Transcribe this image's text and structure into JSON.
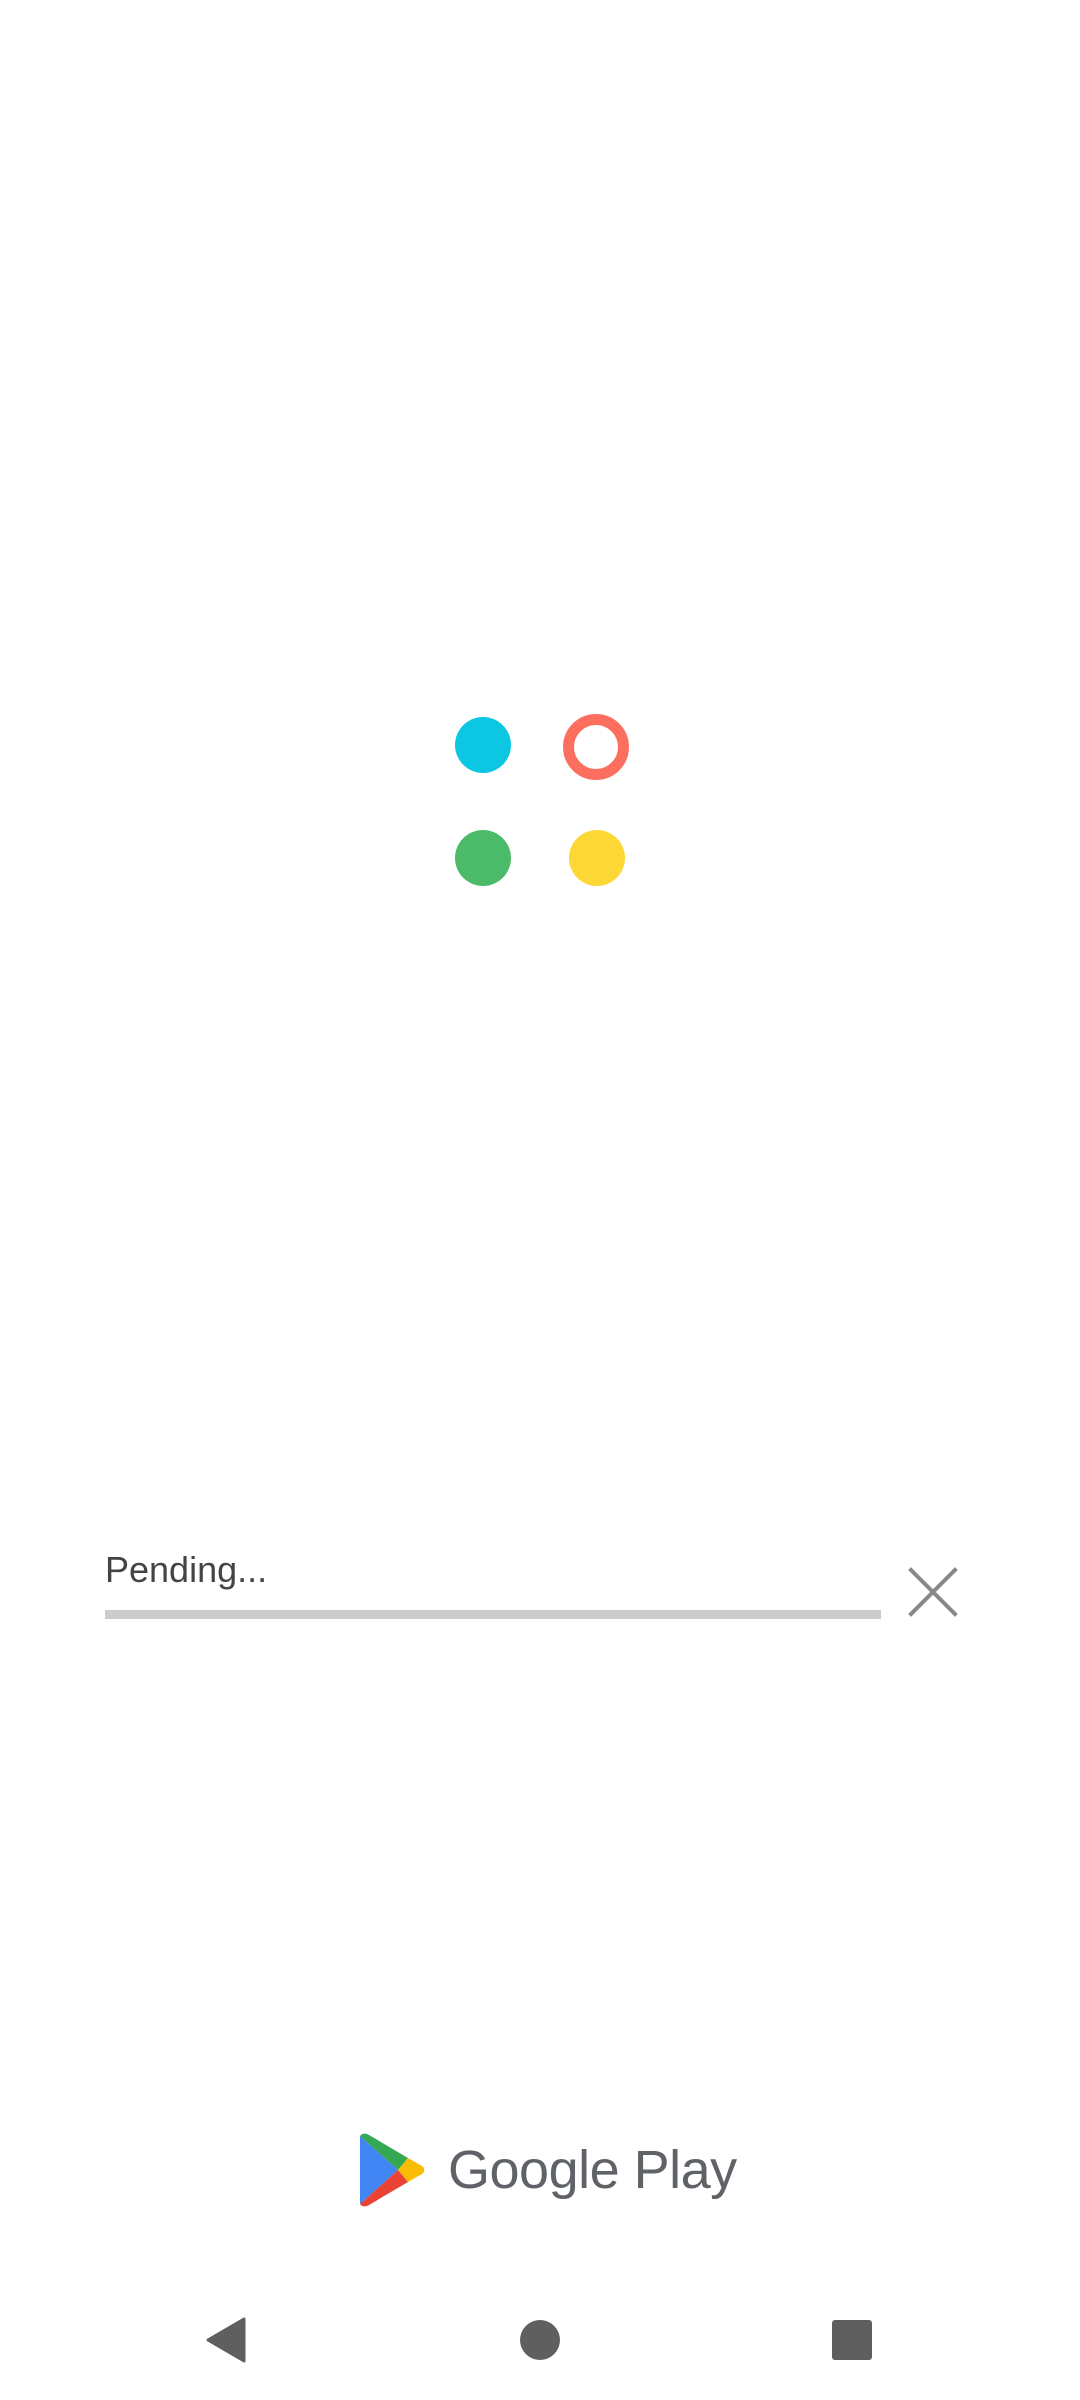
{
  "install": {
    "status": "Pending...",
    "progress": 0,
    "cancel_icon": "close-icon"
  },
  "app_icon": {
    "colors": {
      "top_left": "#0cc7e1",
      "top_right": "#fc6f5f",
      "bottom_left": "#4cbb69",
      "bottom_right": "#fdd736"
    }
  },
  "brand": {
    "name": "Google Play",
    "logo_colors": {
      "blue": "#4285f4",
      "green": "#34a853",
      "yellow": "#fbbc04",
      "red": "#ea4335"
    }
  },
  "navigation": {
    "back_icon": "back-triangle-icon",
    "home_icon": "home-circle-icon",
    "recents_icon": "recents-square-icon"
  },
  "colors": {
    "text": "#444444",
    "track": "#cccccc",
    "icon_gray": "#888888",
    "nav_icon": "#5f5f5f"
  }
}
